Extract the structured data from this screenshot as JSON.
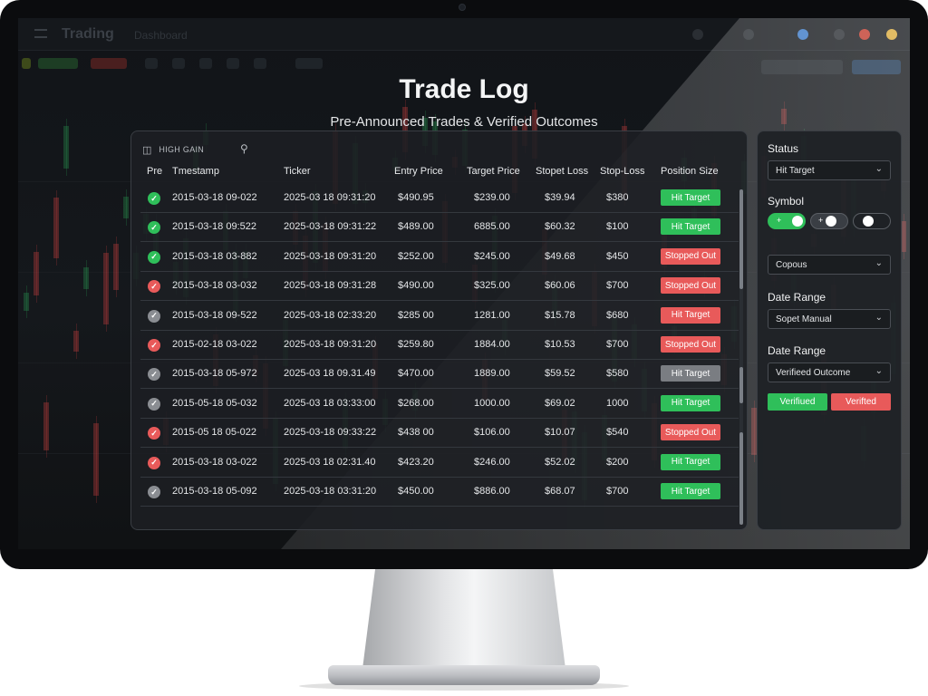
{
  "app": {
    "brand": "Trading",
    "brand_sub": "Dashboard"
  },
  "header": {
    "title": "Trade Log",
    "subtitle": "Pre-Announced Trades & Verified Outcomes"
  },
  "toolbar": {
    "label": "HIGH GAIN",
    "icon_left": "columns-icon",
    "icon_right": "filter-icon"
  },
  "table": {
    "columns": [
      "Pre",
      "Tmestamp",
      "Ticker",
      "Entry Price",
      "Target Price",
      "Stopet Loss",
      "Stop-Loss",
      "Position Size"
    ],
    "rows": [
      {
        "status": "success",
        "timestamp": "2015-03-18 09-022",
        "ticker": "2025-03 18 09:31:20",
        "entry": "$490.95",
        "target": "$239.00",
        "stop1": "$39.94",
        "stop2": "$380",
        "outcome": "Hit Target",
        "outcome_color": "green"
      },
      {
        "status": "success",
        "timestamp": "2015-03-18 09:522",
        "ticker": "2025-03-18 09:31:22",
        "entry": "$489.00",
        "target": "6885.00",
        "stop1": "$60.32",
        "stop2": "$100",
        "outcome": "Hit Target",
        "outcome_color": "green"
      },
      {
        "status": "success",
        "timestamp": "2015-03-18 03-882",
        "ticker": "2025-03-18 09:31:20",
        "entry": "$252.00",
        "target": "$245.00",
        "stop1": "$49.68",
        "stop2": "$450",
        "outcome": "Stopped Out",
        "outcome_color": "red"
      },
      {
        "status": "fail",
        "timestamp": "2015-03-18 03-032",
        "ticker": "2025-03-18 09:31:28",
        "entry": "$490.00",
        "target": "$325.00",
        "stop1": "$60.06",
        "stop2": "$700",
        "outcome": "Stopped Out",
        "outcome_color": "red"
      },
      {
        "status": "neutral",
        "timestamp": "2015-03-18 09-522",
        "ticker": "2025-03-18 02:33:20",
        "entry": "$285 00",
        "target": "1281.00",
        "stop1": "$15.78",
        "stop2": "$680",
        "outcome": "Hit Target",
        "outcome_color": "red"
      },
      {
        "status": "fail",
        "timestamp": "2015-02-18 03-022",
        "ticker": "2025-03-18 09:31:20",
        "entry": "$259.80",
        "target": "1884.00",
        "stop1": "$10.53",
        "stop2": "$700",
        "outcome": "Stopped Out",
        "outcome_color": "red"
      },
      {
        "status": "neutral",
        "timestamp": "2015-03-18 05-972",
        "ticker": "2025-03 18 09.31.49",
        "entry": "$470.00",
        "target": "1889.00",
        "stop1": "$59.52",
        "stop2": "$580",
        "outcome": "Hit Target",
        "outcome_color": "gray"
      },
      {
        "status": "neutral",
        "timestamp": "2015-05-18 05-032",
        "ticker": "2025-03 18 03:33:00",
        "entry": "$268.00",
        "target": "1000.00",
        "stop1": "$69.02",
        "stop2": "1000",
        "outcome": "Hit Target",
        "outcome_color": "green"
      },
      {
        "status": "fail",
        "timestamp": "2015-05 18 05-022",
        "ticker": "2025-03-18 09:33:22",
        "entry": "$438 00",
        "target": "$106.00",
        "stop1": "$10.07",
        "stop2": "$540",
        "outcome": "Stopped Out",
        "outcome_color": "red"
      },
      {
        "status": "fail",
        "timestamp": "2015-03-18 03-022",
        "ticker": "2025-03 18 02:31.40",
        "entry": "$423.20",
        "target": "$246.00",
        "stop1": "$52.02",
        "stop2": "$200",
        "outcome": "Hit Target",
        "outcome_color": "green"
      },
      {
        "status": "neutral",
        "timestamp": "2015-03-18 05-092",
        "ticker": "2025-03-18 03:31:20",
        "entry": "$450.00",
        "target": "$886.00",
        "stop1": "$68.07",
        "stop2": "$700",
        "outcome": "Hit Target",
        "outcome_color": "green"
      }
    ]
  },
  "filters": {
    "status": {
      "label": "Status",
      "value": "Hit Target"
    },
    "symbol": {
      "label": "Symbol",
      "toggles": [
        {
          "mark": "+",
          "state": "on",
          "color": "green"
        },
        {
          "mark": "+",
          "state": "on",
          "color": "dark"
        },
        {
          "mark": "",
          "state": "off",
          "color": "dark"
        }
      ],
      "value": "Copous"
    },
    "date_range_1": {
      "label": "Date Range",
      "value": "Sopet Manual"
    },
    "date_range_2": {
      "label": "Date Range",
      "value": "Verifieed Outcome"
    },
    "buttons": {
      "verified_label": "Verifiued",
      "verifed_label": "Verifted"
    }
  },
  "colors": {
    "green": "#2fbf5a",
    "red": "#e85a5a",
    "gray": "#7a7d82",
    "neutral_dot": "#8a8d92"
  }
}
